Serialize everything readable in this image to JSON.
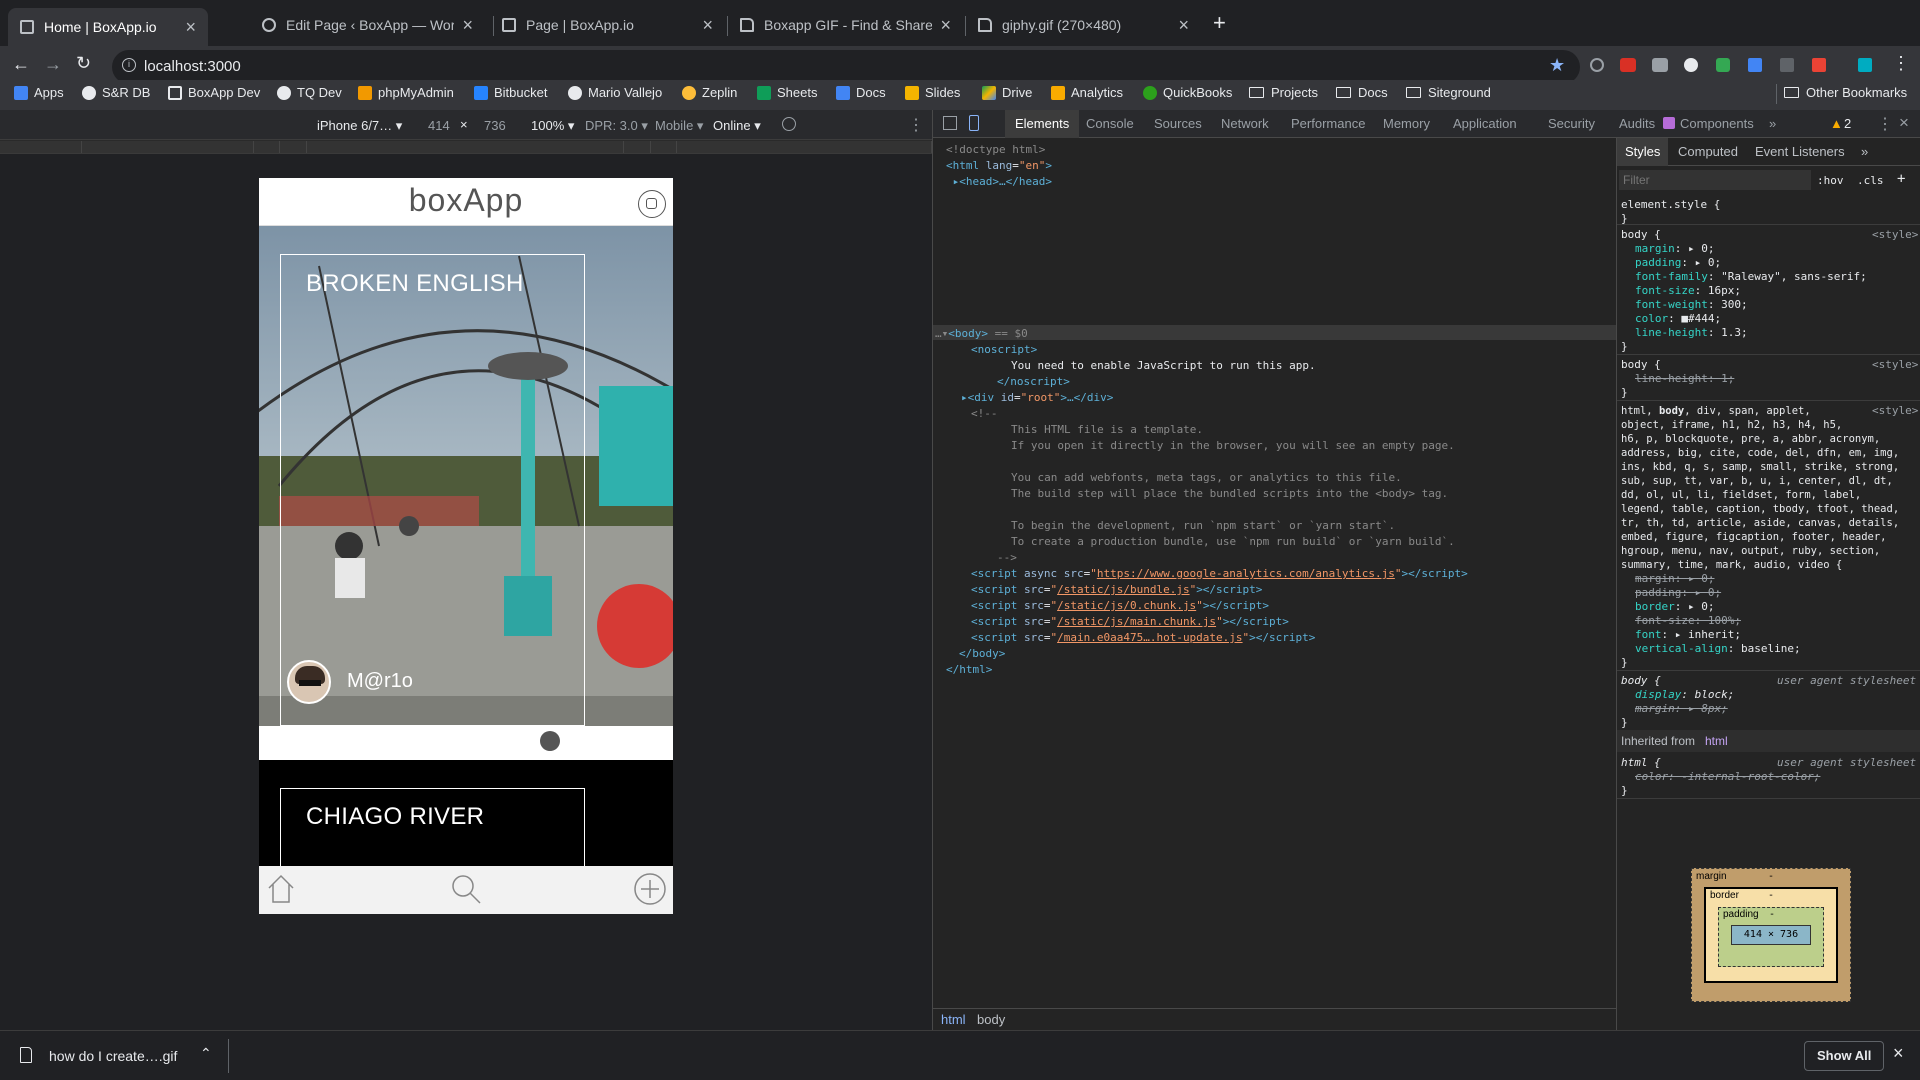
{
  "tabs": [
    {
      "title": "Home | BoxApp.io",
      "active": true
    },
    {
      "title": "Edit Page ‹ BoxApp — WordPr",
      "active": false
    },
    {
      "title": "Page | BoxApp.io",
      "active": false
    },
    {
      "title": "Boxapp GIF - Find & Share on G",
      "active": false
    },
    {
      "title": "giphy.gif (270×480)",
      "active": false
    }
  ],
  "address": {
    "url": "localhost:3000"
  },
  "bookmarks": [
    {
      "label": "Apps"
    },
    {
      "label": "S&R DB"
    },
    {
      "label": "BoxApp Dev"
    },
    {
      "label": "TQ Dev"
    },
    {
      "label": "phpMyAdmin"
    },
    {
      "label": "Bitbucket"
    },
    {
      "label": "Mario Vallejo"
    },
    {
      "label": "Zeplin"
    },
    {
      "label": "Sheets"
    },
    {
      "label": "Docs"
    },
    {
      "label": "Slides"
    },
    {
      "label": "Drive"
    },
    {
      "label": "Analytics"
    },
    {
      "label": "QuickBooks"
    },
    {
      "label": "Projects"
    },
    {
      "label": "Docs"
    },
    {
      "label": "Siteground"
    }
  ],
  "other_bookmarks": "Other Bookmarks",
  "device_toolbar": {
    "device": "iPhone 6/7…",
    "width": "414",
    "times": "×",
    "height": "736",
    "zoom": "100%",
    "dpr": "DPR: 3.0",
    "mode": "Mobile",
    "network": "Online"
  },
  "app": {
    "logo": "boxApp",
    "cards": [
      {
        "title": "BROKEN ENGLISH",
        "user": "M@r1o"
      },
      {
        "title": "CHIAGO RIVER"
      }
    ]
  },
  "devtools": {
    "tabs": [
      "Elements",
      "Console",
      "Sources",
      "Network",
      "Performance",
      "Memory",
      "Application",
      "Security",
      "Audits",
      "Components",
      "»"
    ],
    "warning_count": "2",
    "styles_tabs": [
      "Styles",
      "Computed",
      "Event Listeners",
      "»"
    ],
    "filter_placeholder": "Filter",
    "hov": ":hov",
    "cls": ".cls",
    "crumbs": [
      "html",
      "body"
    ],
    "box_model": {
      "margin": "margin",
      "border": "border",
      "padding": "padding",
      "content": "414 × 736",
      "dash": "-"
    },
    "inherited_label": "Inherited from",
    "inherited_tag": "html"
  },
  "download": {
    "file": "how do I create….gif",
    "show_all": "Show All"
  },
  "colors": {
    "chrome_bg": "#202124",
    "toolbar": "#35363a",
    "star": "#8ab4f8",
    "devtools_bg": "#242424"
  }
}
